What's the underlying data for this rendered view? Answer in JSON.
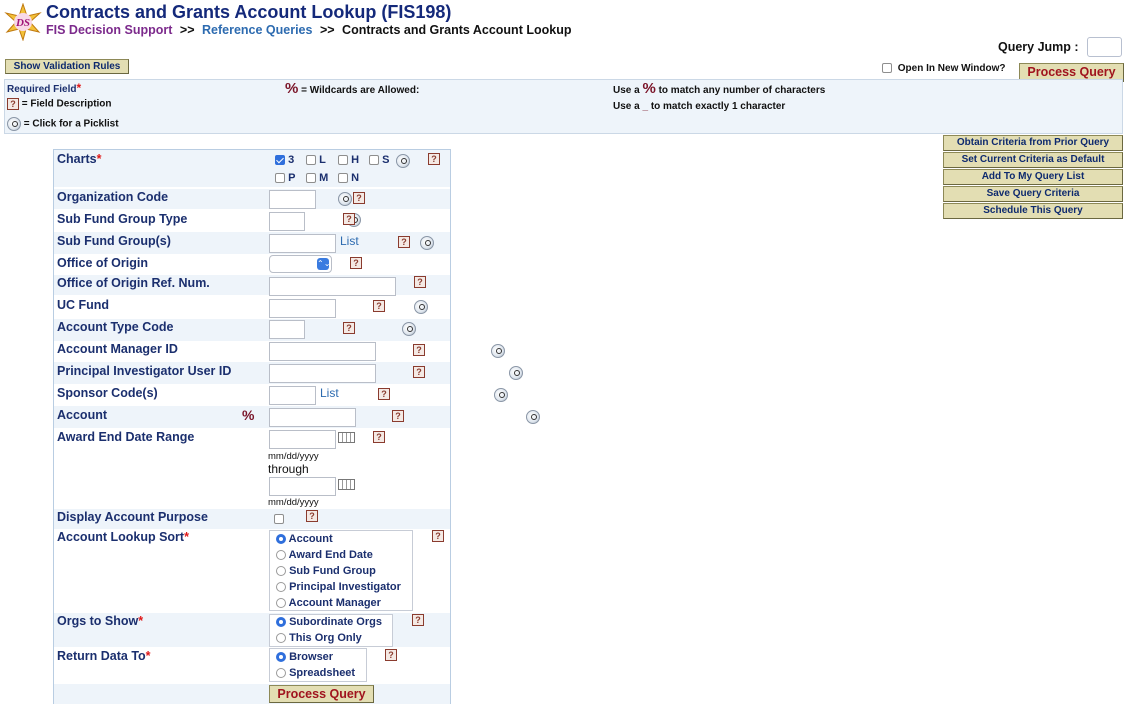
{
  "header": {
    "title": "Contracts and Grants Account Lookup (FIS198)",
    "logo_text": "DS",
    "breadcrumb": {
      "home": "FIS Decision Support",
      "sep1": ">>",
      "section": "Reference Queries",
      "sep2": ">>",
      "current": "Contracts and Grants Account Lookup"
    }
  },
  "toolbar": {
    "query_jump_label": "Query Jump :",
    "query_jump_value": "",
    "show_validation_label": "Show Validation Rules",
    "open_new_window_label": "Open In New Window?",
    "open_new_window_checked": false,
    "process_query_label": "Process Query"
  },
  "legend": {
    "required_field": "Required Field",
    "star": "*",
    "field_description": "= Field Description",
    "picklist": "= Click for a Picklist",
    "wildcard_symbol": "%",
    "wildcards_allowed": "= Wildcards are Allowed:",
    "use_a": "Use a",
    "match_any": "to match any number of characters",
    "underscore": "_",
    "match_one": "to match exactly 1 character"
  },
  "side_buttons": [
    "Obtain Criteria from Prior Query",
    "Set Current Criteria as Default",
    "Add To My Query List",
    "Save Query Criteria",
    "Schedule This Query"
  ],
  "form": {
    "charts": {
      "label": "Charts",
      "options": [
        {
          "code": "3",
          "checked": true
        },
        {
          "code": "L",
          "checked": false
        },
        {
          "code": "H",
          "checked": false
        },
        {
          "code": "S",
          "checked": false
        },
        {
          "code": "P",
          "checked": false
        },
        {
          "code": "M",
          "checked": false
        },
        {
          "code": "N",
          "checked": false
        }
      ]
    },
    "organization_code": {
      "label": "Organization Code",
      "value": ""
    },
    "sub_fund_group_type": {
      "label": "Sub Fund Group Type",
      "value": ""
    },
    "sub_fund_groups": {
      "label": "Sub Fund Group(s)",
      "value": "",
      "list_label": "List"
    },
    "office_of_origin": {
      "label": "Office of Origin",
      "value": ""
    },
    "office_of_origin_ref": {
      "label": "Office of Origin Ref. Num.",
      "value": ""
    },
    "uc_fund": {
      "label": "UC Fund",
      "value": ""
    },
    "account_type_code": {
      "label": "Account Type Code",
      "value": ""
    },
    "account_manager_id": {
      "label": "Account Manager ID",
      "value": ""
    },
    "pi_user_id": {
      "label": "Principal Investigator User ID",
      "value": ""
    },
    "sponsor_codes": {
      "label": "Sponsor Code(s)",
      "value": "",
      "list_label": "List"
    },
    "account": {
      "label": "Account",
      "wildcard": "%",
      "value": ""
    },
    "award_end_date_range": {
      "label": "Award End Date Range",
      "from_value": "",
      "to_value": "",
      "format_hint": "mm/dd/yyyy",
      "through_label": "through"
    },
    "display_account_purpose": {
      "label": "Display Account Purpose",
      "checked": false
    },
    "account_lookup_sort": {
      "label": "Account Lookup Sort",
      "options": [
        "Account",
        "Award End Date",
        "Sub Fund Group",
        "Principal Investigator",
        "Account Manager"
      ],
      "selected": "Account"
    },
    "orgs_to_show": {
      "label": "Orgs to Show",
      "options": [
        "Subordinate Orgs",
        "This Org Only"
      ],
      "selected": "Subordinate Orgs"
    },
    "return_data_to": {
      "label": "Return Data To",
      "options": [
        "Browser",
        "Spreadsheet"
      ],
      "selected": "Browser"
    },
    "process_query_label": "Process Query"
  },
  "icons": {
    "help": "?",
    "select_caret": "⌃⌄"
  },
  "colors": {
    "title": "#14297a",
    "breadcrumb_home": "#7c2a8c",
    "breadcrumb_link": "#2d6bb0",
    "panel_bg": "#eef4fa",
    "button_bg": "#e3deb3",
    "process_text": "#a0141e",
    "required_star": "#e01818"
  }
}
